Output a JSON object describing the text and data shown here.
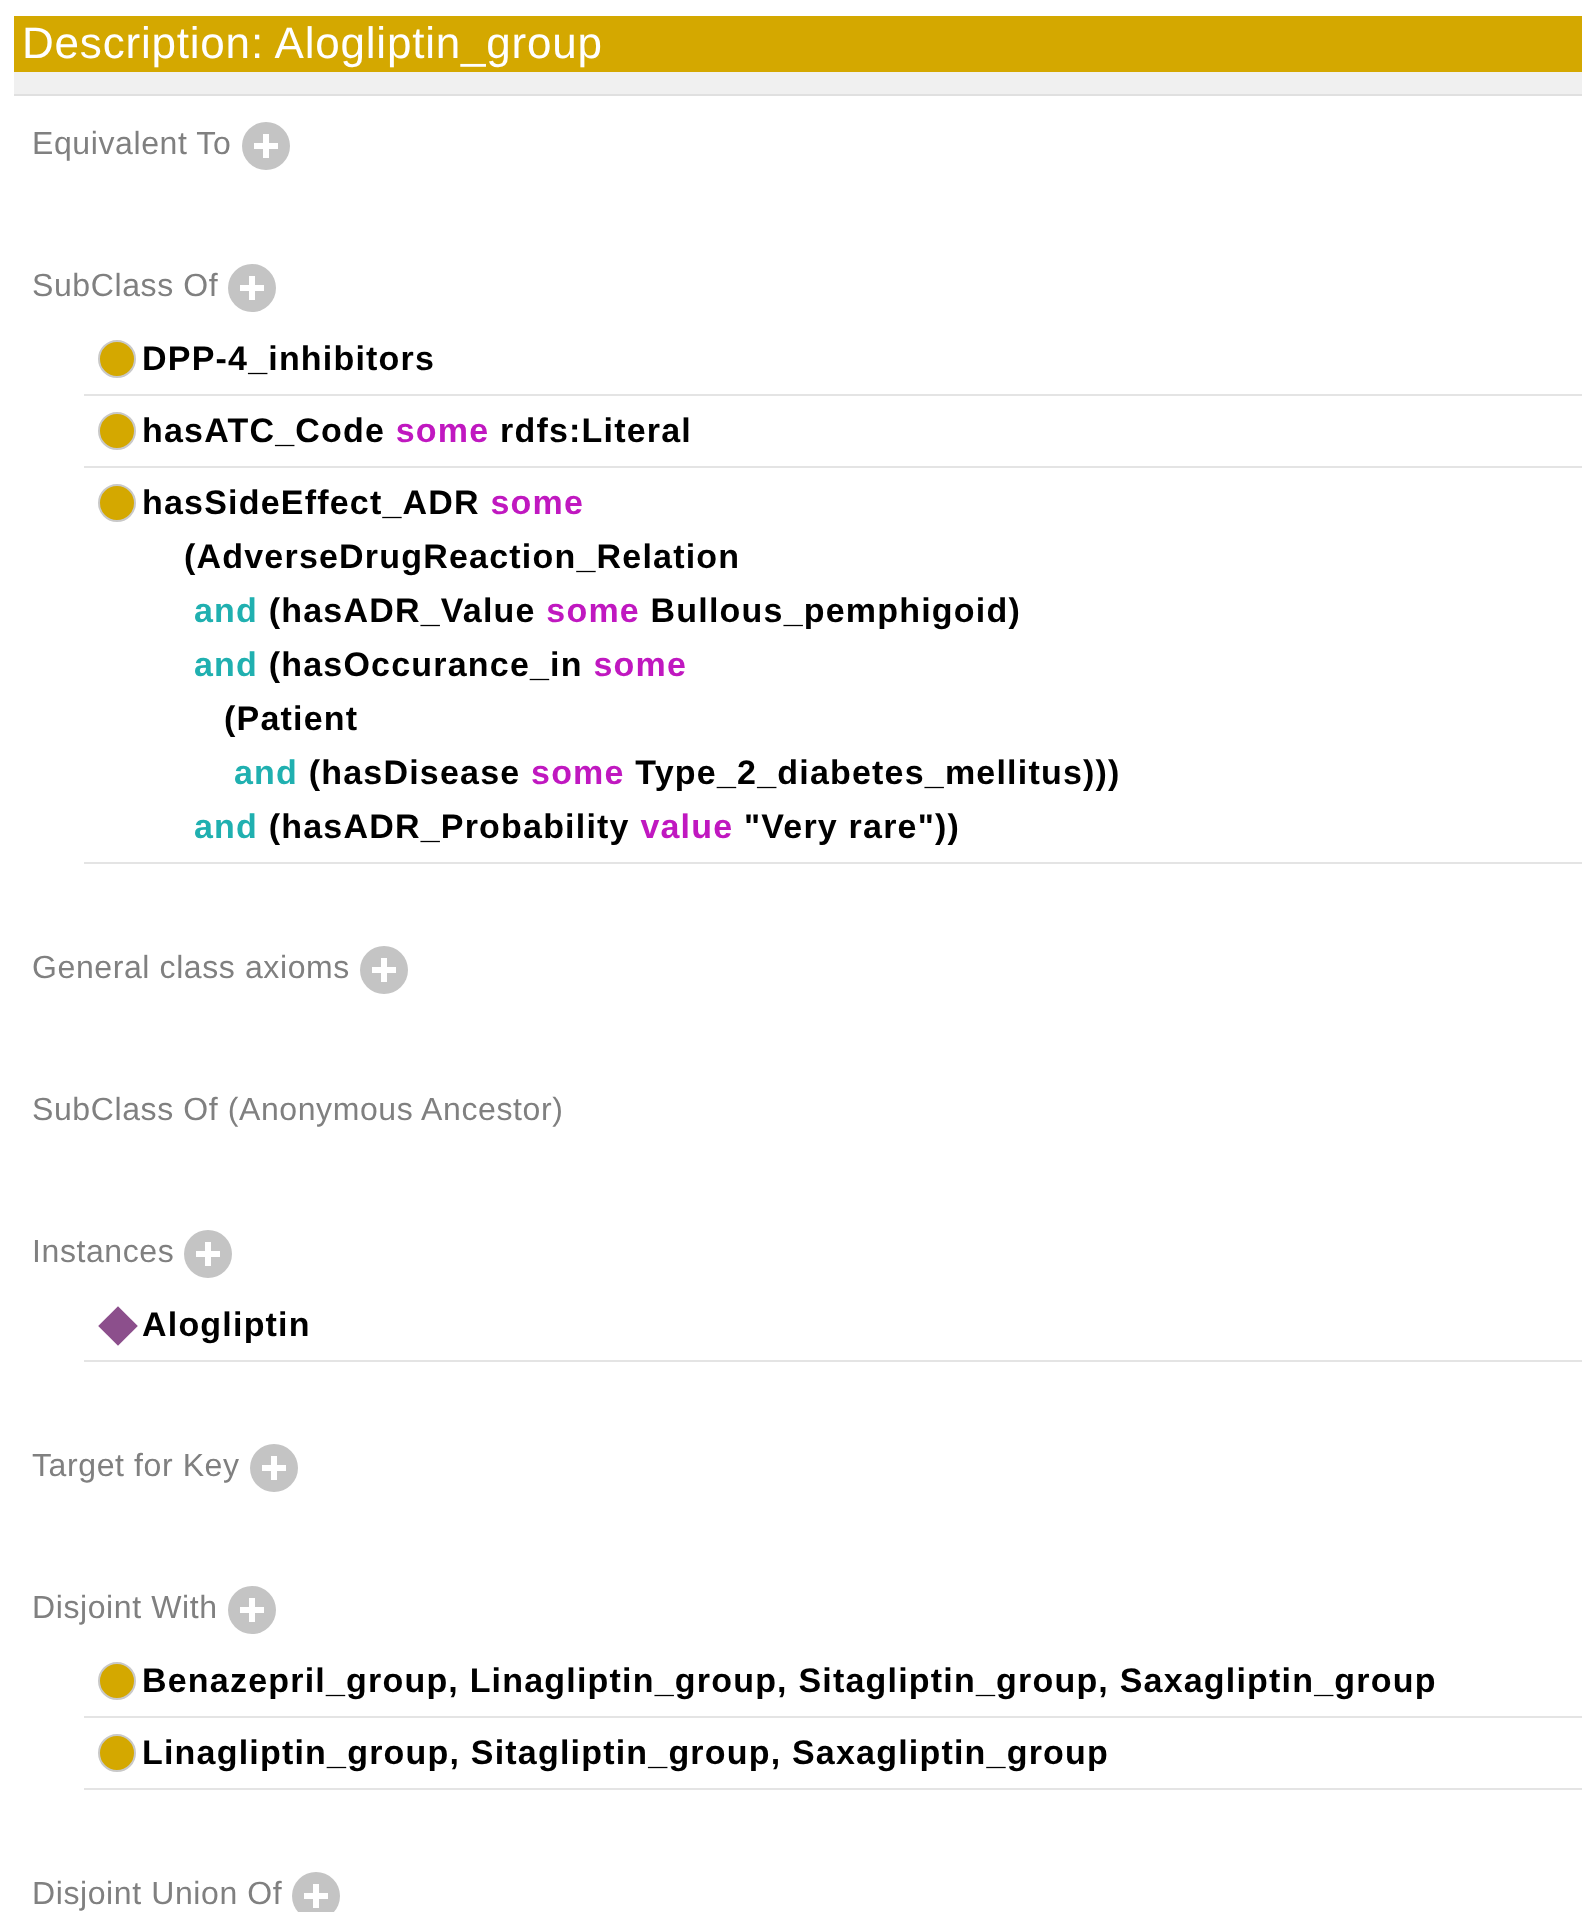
{
  "header": {
    "title": "Description: Alogliptin_group"
  },
  "sections": [
    {
      "label": "Equivalent To",
      "addable": true
    },
    {
      "label": "SubClass Of",
      "addable": true,
      "items": [
        {
          "kind": "class",
          "lines": [
            {
              "tokens": [
                {
                  "kind": "name",
                  "text": "DPP-4_inhibitors"
                }
              ]
            }
          ]
        },
        {
          "kind": "class",
          "lines": [
            {
              "tokens": [
                {
                  "kind": "name",
                  "text": "hasATC_Code"
                },
                {
                  "kind": "keyword",
                  "text": "some"
                },
                {
                  "kind": "name",
                  "text": "rdfs:Literal"
                }
              ]
            }
          ]
        },
        {
          "kind": "class",
          "lines": [
            {
              "tokens": [
                {
                  "kind": "name",
                  "text": "hasSideEffect_ADR"
                },
                {
                  "kind": "keyword",
                  "text": "some"
                }
              ],
              "children": [
                {
                  "tokens": [
                    {
                      "kind": "name",
                      "text": "(AdverseDrugReaction_Relation"
                    }
                  ],
                  "children": [
                    {
                      "tokens": [
                        {
                          "kind": "connective",
                          "text": "and"
                        },
                        {
                          "kind": "name",
                          "text": "(hasADR_Value"
                        },
                        {
                          "kind": "keyword",
                          "text": "some"
                        },
                        {
                          "kind": "name",
                          "text": "Bullous_pemphigoid)"
                        }
                      ]
                    },
                    {
                      "tokens": [
                        {
                          "kind": "connective",
                          "text": "and"
                        },
                        {
                          "kind": "name",
                          "text": "(hasOccurance_in"
                        },
                        {
                          "kind": "keyword",
                          "text": "some"
                        }
                      ],
                      "children": [
                        {
                          "tokens": [
                            {
                              "kind": "name",
                              "text": "(Patient"
                            }
                          ],
                          "children": [
                            {
                              "tokens": [
                                {
                                  "kind": "connective",
                                  "text": "and"
                                },
                                {
                                  "kind": "name",
                                  "text": "(hasDisease"
                                },
                                {
                                  "kind": "keyword",
                                  "text": "some"
                                },
                                {
                                  "kind": "name",
                                  "text": "Type_2_diabetes_mellitus)))"
                                }
                              ]
                            }
                          ]
                        }
                      ]
                    },
                    {
                      "tokens": [
                        {
                          "kind": "connective",
                          "text": "and"
                        },
                        {
                          "kind": "name",
                          "text": "(hasADR_Probability"
                        },
                        {
                          "kind": "keyword",
                          "text": "value"
                        },
                        {
                          "kind": "name",
                          "text": "\"Very rare\"))"
                        }
                      ]
                    }
                  ]
                }
              ]
            }
          ]
        }
      ]
    },
    {
      "label": "General class axioms",
      "addable": true
    },
    {
      "label": "SubClass Of (Anonymous Ancestor)",
      "addable": false
    },
    {
      "label": "Instances",
      "addable": true,
      "items": [
        {
          "kind": "individual",
          "lines": [
            {
              "tokens": [
                {
                  "kind": "name",
                  "text": "Alogliptin"
                }
              ]
            }
          ]
        }
      ]
    },
    {
      "label": "Target for Key",
      "addable": true
    },
    {
      "label": "Disjoint With",
      "addable": true,
      "items": [
        {
          "kind": "class",
          "lines": [
            {
              "tokens": [
                {
                  "kind": "name",
                  "text": "Benazepril_group, Linagliptin_group, Sitagliptin_group, Saxagliptin_group"
                }
              ]
            }
          ]
        },
        {
          "kind": "class",
          "lines": [
            {
              "tokens": [
                {
                  "kind": "name",
                  "text": "Linagliptin_group, Sitagliptin_group, Saxagliptin_group"
                }
              ]
            }
          ]
        }
      ]
    },
    {
      "label": "Disjoint Union Of",
      "addable": true
    }
  ]
}
